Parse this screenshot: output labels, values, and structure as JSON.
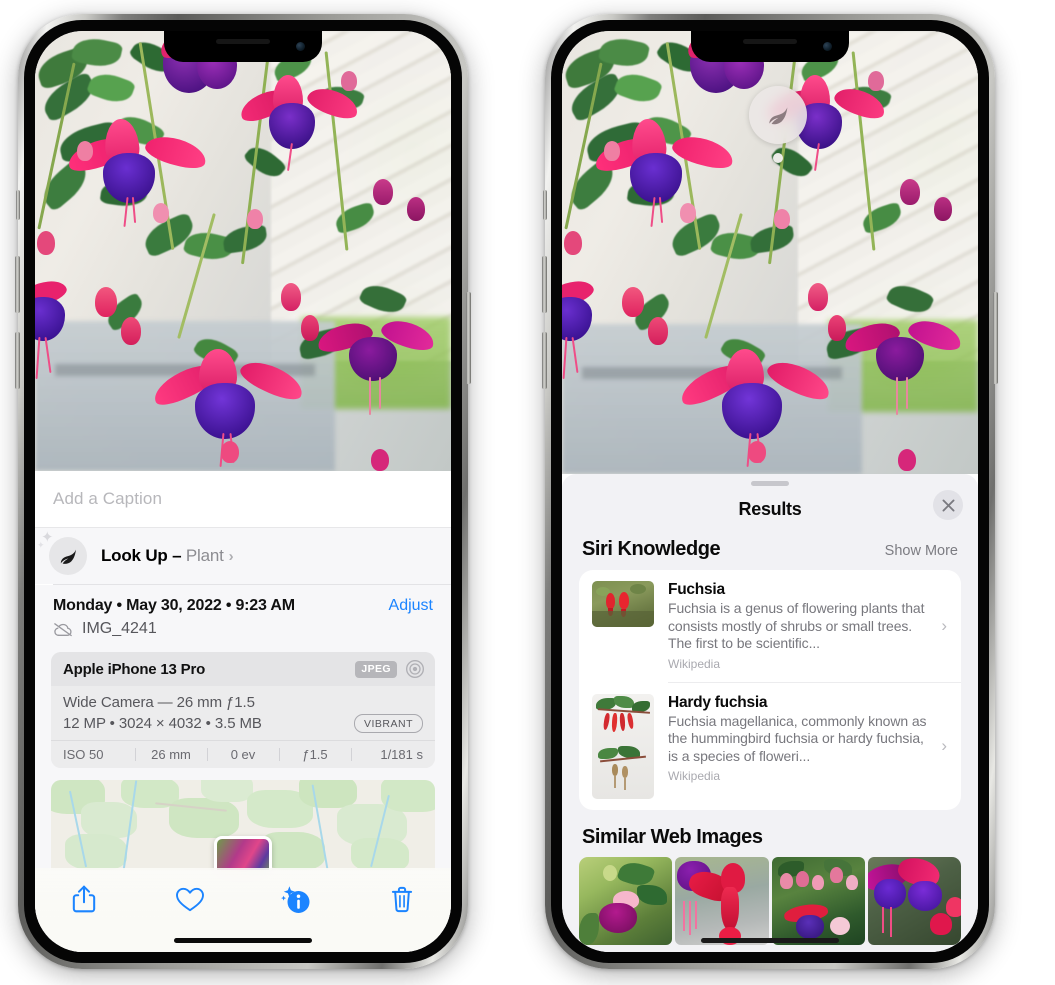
{
  "left_phone": {
    "name": "iPhone showing Photos info sheet",
    "caption_field": {
      "placeholder": "Add a Caption",
      "value": ""
    },
    "look_up": {
      "icon": "leaf-icon",
      "label": "Look Up",
      "dash": "–",
      "kind": "Plant",
      "chevron": "›"
    },
    "date_row": {
      "date_text": "Monday • May 30, 2022 • 9:23 AM",
      "adjust_label": "Adjust",
      "cloud_icon": "cloud-slash-icon",
      "file_name": "IMG_4241"
    },
    "exif": {
      "model": "Apple iPhone 13 Pro",
      "format_badge": "JPEG",
      "aperture_icon": "aperture-icon",
      "lens_line": "Wide Camera — 26 mm ƒ1.5",
      "specs_line": "12 MP • 3024 × 4032 • 3.5 MB",
      "style_badge": "VIBRANT",
      "stats": [
        "ISO 50",
        "26 mm",
        "0 ev",
        "ƒ1.5",
        "1/181 s"
      ]
    },
    "map": {
      "pin_label": "photo-location-pin"
    },
    "toolbar": [
      {
        "name": "share-button",
        "icon": "share-icon"
      },
      {
        "name": "favorite-button",
        "icon": "heart-icon"
      },
      {
        "name": "info-button",
        "icon": "info-sparkle-icon"
      },
      {
        "name": "delete-button",
        "icon": "trash-icon"
      }
    ],
    "accent_color": "#1b84ff"
  },
  "right_phone": {
    "name": "iPhone showing Visual Look Up results",
    "badge": {
      "icon": "leaf-icon",
      "name": "visual-look-up-badge"
    },
    "sheet": {
      "title": "Results",
      "close_icon": "close-icon"
    },
    "siri_knowledge": {
      "heading": "Siri Knowledge",
      "show_more": "Show More",
      "items": [
        {
          "title": "Fuchsia",
          "description": "Fuchsia is a genus of flowering plants that consists mostly of shrubs or small trees. The first to be scientific...",
          "source": "Wikipedia",
          "chevron": "›"
        },
        {
          "title": "Hardy fuchsia",
          "description": "Fuchsia magellanica, commonly known as the hummingbird fuchsia or hardy fuchsia, is a species of floweri...",
          "source": "Wikipedia",
          "chevron": "›"
        }
      ]
    },
    "similar_web_images": {
      "heading": "Similar Web Images",
      "thumbnails": [
        "web-image-1",
        "web-image-2",
        "web-image-3",
        "web-image-4"
      ]
    },
    "panel_color": "#f2f2f5"
  }
}
